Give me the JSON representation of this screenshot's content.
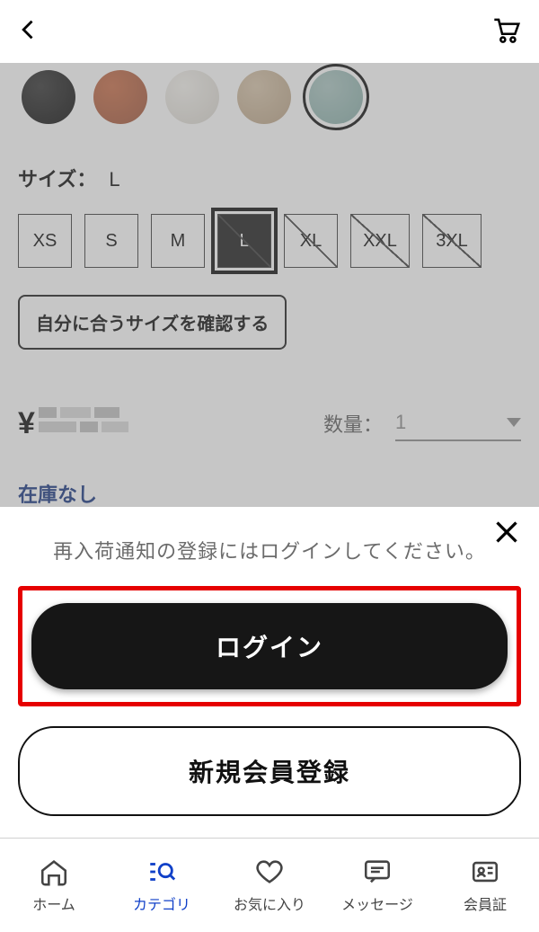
{
  "product": {
    "size_label": "サイズ：",
    "size_value": "L",
    "sizes": [
      "XS",
      "S",
      "M",
      "L",
      "XL",
      "XXL",
      "3XL"
    ],
    "size_selected_index": 3,
    "size_na_indices": [
      3,
      4,
      5,
      6
    ],
    "fit_check_label": "自分に合うサイズを確認する",
    "currency": "¥",
    "qty_label": "数量：",
    "qty_value": "1",
    "stock_status": "在庫なし"
  },
  "sheet": {
    "message": "再入荷通知の登録にはログインしてください。",
    "login_label": "ログイン",
    "register_label": "新規会員登録"
  },
  "nav": {
    "home": "ホーム",
    "category": "カテゴリ",
    "favorite": "お気に入り",
    "message": "メッセージ",
    "member": "会員証"
  }
}
